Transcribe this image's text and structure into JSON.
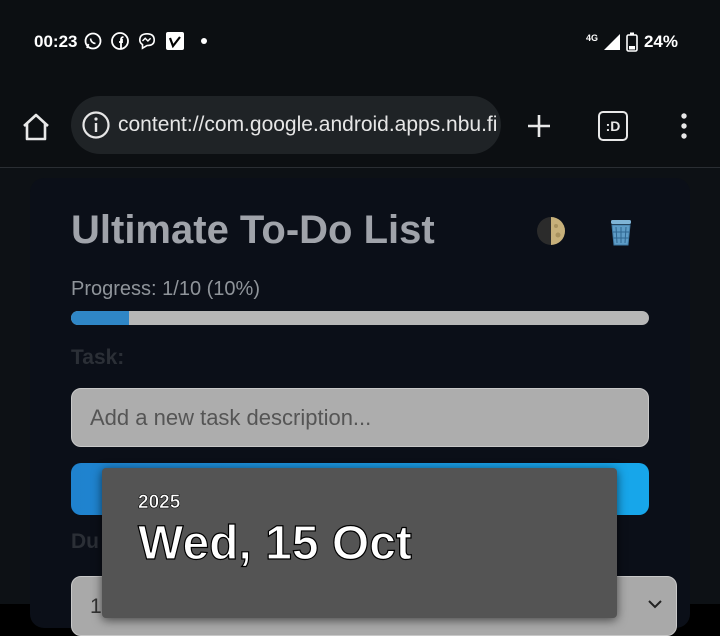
{
  "status_bar": {
    "time": "00:23",
    "network": "4G",
    "battery": "24%",
    "notification_icons": [
      "whatsapp-icon",
      "facebook-icon",
      "messenger-icon",
      "vimeo-icon"
    ]
  },
  "browser": {
    "url": "content://com.google.android.apps.nbu.fi",
    "icons": [
      "home-icon",
      "site-info-icon",
      "new-tab-icon",
      "tab-switcher-icon",
      "more-options-icon"
    ],
    "tab_switcher_label": ":D"
  },
  "app": {
    "title": "Ultimate To-Do List",
    "progress": {
      "label": "Progress: 1/10 (10%)",
      "fraction": 0.1
    },
    "task_label": "Task:",
    "task_placeholder": "Add a new task description...",
    "due_label": "Du",
    "date_select_value": "1",
    "colors": {
      "accent": "#1f82ce",
      "progress_fill": "#2f86c6"
    }
  },
  "date_picker": {
    "year": "2025",
    "date": "Wed, 15 Oct"
  }
}
